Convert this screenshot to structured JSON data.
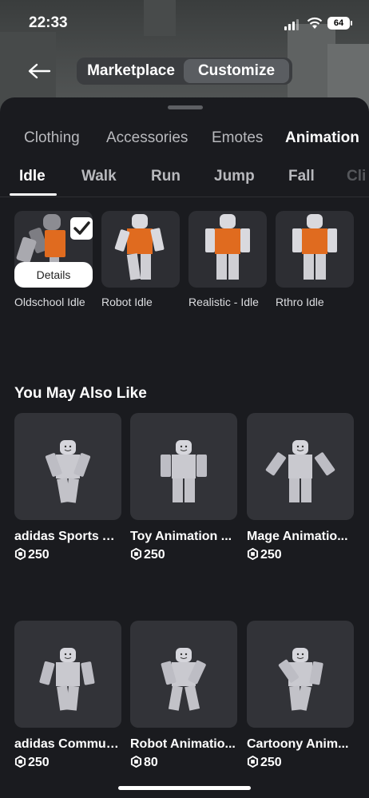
{
  "status": {
    "time": "22:33",
    "battery": "64"
  },
  "topbar": {
    "back_icon": "arrow-left-icon",
    "segments": [
      "Marketplace",
      "Customize"
    ],
    "selected_segment": "Customize"
  },
  "categories": [
    "Clothing",
    "Accessories",
    "Emotes",
    "Animation"
  ],
  "selected_category": "Animation",
  "subtabs": [
    "Idle",
    "Walk",
    "Run",
    "Jump",
    "Fall",
    "Cli"
  ],
  "selected_subtab": "Idle",
  "owned": [
    {
      "label": "Oldschool Idle",
      "details": "Details",
      "equipped": true
    },
    {
      "label": "Robot Idle"
    },
    {
      "label": "Realistic - Idle"
    },
    {
      "label": "Rthro Idle"
    }
  ],
  "recommend": {
    "title": "You May Also Like",
    "items": [
      {
        "name": "adidas Sports A...",
        "price": "250"
      },
      {
        "name": "Toy Animation ...",
        "price": "250"
      },
      {
        "name": "Mage Animatio...",
        "price": "250"
      },
      {
        "name": "adidas Commun...",
        "price": "250"
      },
      {
        "name": "Robot Animatio...",
        "price": "80"
      },
      {
        "name": "Cartoony Anim...",
        "price": "250"
      }
    ]
  },
  "colors": {
    "background": "#1a1b1f",
    "card": "#323338",
    "torso_orange": "#e06b1f",
    "avatar_gray": "#c9c9cf"
  }
}
